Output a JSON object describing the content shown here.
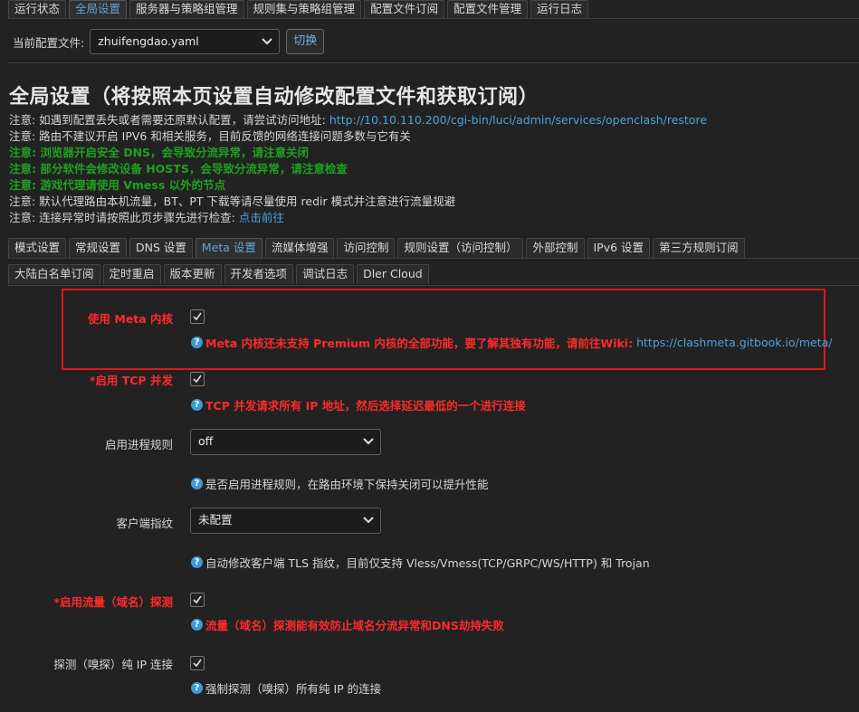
{
  "top_tabs": [
    "运行状态",
    "全局设置",
    "服务器与策略组管理",
    "规则集与策略组管理",
    "配置文件订阅",
    "配置文件管理",
    "运行日志"
  ],
  "active_top_tab": 1,
  "config": {
    "label": "当前配置文件:",
    "selected": "zhuifengdao.yaml",
    "switch_button": "切换"
  },
  "page_title": "全局设置（将按照本页设置自动修改配置文件和获取订阅）",
  "notes": [
    {
      "text": "注意: 如遇到配置丢失或者需要还原默认配置，请尝试访问地址: ",
      "link": "http://10.10.110.200/cgi-bin/luci/admin/services/openclash/restore",
      "style": "normal"
    },
    {
      "text": "注意: 路由不建议开启 IPV6 和相关服务，目前反馈的网络连接问题多数与它有关",
      "link": "",
      "style": "normal"
    },
    {
      "text": "注意: 浏览器开启安全 DNS，会导致分流异常，请注意关闭",
      "link": "",
      "style": "green"
    },
    {
      "text": "注意: 部分软件会修改设备 HOSTS，会导致分流异常，请注意检查",
      "link": "",
      "style": "green"
    },
    {
      "text": "注意: 游戏代理请使用 Vmess 以外的节点",
      "link": "",
      "style": "green"
    },
    {
      "text": "注意: 默认代理路由本机流量，BT、PT 下载等请尽量使用 redir 模式并注意进行流量规避",
      "link": "",
      "style": "normal"
    },
    {
      "text": "注意: 连接异常时请按照此页步骤先进行检查: ",
      "link": "点击前往",
      "style": "normal"
    }
  ],
  "section_tabs_row1": [
    "模式设置",
    "常规设置",
    "DNS 设置",
    "Meta 设置",
    "流媒体增强",
    "访问控制",
    "规则设置（访问控制）",
    "外部控制",
    "IPv6 设置",
    "第三方规则订阅"
  ],
  "active_section_tab": 3,
  "section_tabs_row2": [
    "大陆白名单订阅",
    "定时重启",
    "版本更新",
    "开发者选项",
    "调试日志",
    "Dler Cloud"
  ],
  "fields": {
    "meta_core": {
      "label": "使用 Meta 内核",
      "checked": true,
      "help": "Meta 内核还未支持 Premium 内核的全部功能，要了解其独有功能，请前往Wiki:",
      "help_link": "https://clashmeta.gitbook.io/meta/"
    },
    "tcp_concurrent": {
      "label": "*启用 TCP 并发",
      "checked": true,
      "help": "TCP 并发请求所有 IP 地址，然后选择延迟最低的一个进行连接"
    },
    "process_rule": {
      "label": "启用进程规则",
      "value": "off",
      "help": "是否启用进程规则，在路由环境下保持关闭可以提升性能"
    },
    "client_fingerprint": {
      "label": "客户端指纹",
      "value": "未配置",
      "help": "自动修改客户端 TLS 指纹，目前仅支持 Vless/Vmess(TCP/GRPC/WS/HTTP) 和 Trojan"
    },
    "sniffer": {
      "label": "*启用流量（域名）探测",
      "checked": true,
      "help": "流量（域名）探测能有效防止域名分流异常和DNS劫持失败"
    },
    "sniff_pure_ip": {
      "label": "探测（嗅探）纯 IP 连接",
      "checked": true,
      "help": "强制探测（嗅探）所有纯 IP 的连接"
    }
  },
  "colors": {
    "background": "#222222",
    "accent": "#5ea7d8",
    "warning_red": "#ff2a2a",
    "note_green": "#1ea21e",
    "highlight_box": "#e01818"
  }
}
